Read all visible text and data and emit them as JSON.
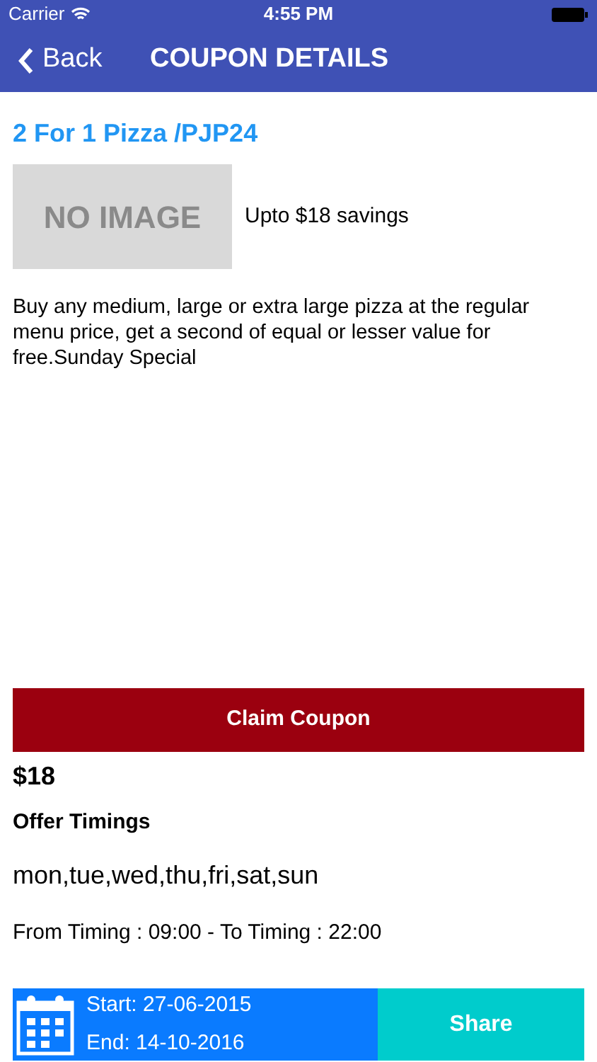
{
  "status_bar": {
    "carrier": "Carrier",
    "time": "4:55 PM"
  },
  "nav": {
    "back": "Back",
    "title": "COUPON DETAILS"
  },
  "coupon": {
    "title": "2 For 1 Pizza /PJP24",
    "image_text": "NO IMAGE",
    "savings": "Upto $18 savings",
    "description": "Buy any medium, large or extra large pizza at the regular menu price, get a second of equal or lesser value for free.Sunday Special"
  },
  "claim_button": "Claim Coupon",
  "price": "$18",
  "offer_timings": {
    "heading": "Offer Timings",
    "days": "mon,tue,wed,thu,fri,sat,sun",
    "hours": "From Timing : 09:00 - To Timing : 22:00"
  },
  "validity": {
    "start": "Start: 27-06-2015",
    "end": "End: 14-10-2016"
  },
  "share_button": "Share"
}
